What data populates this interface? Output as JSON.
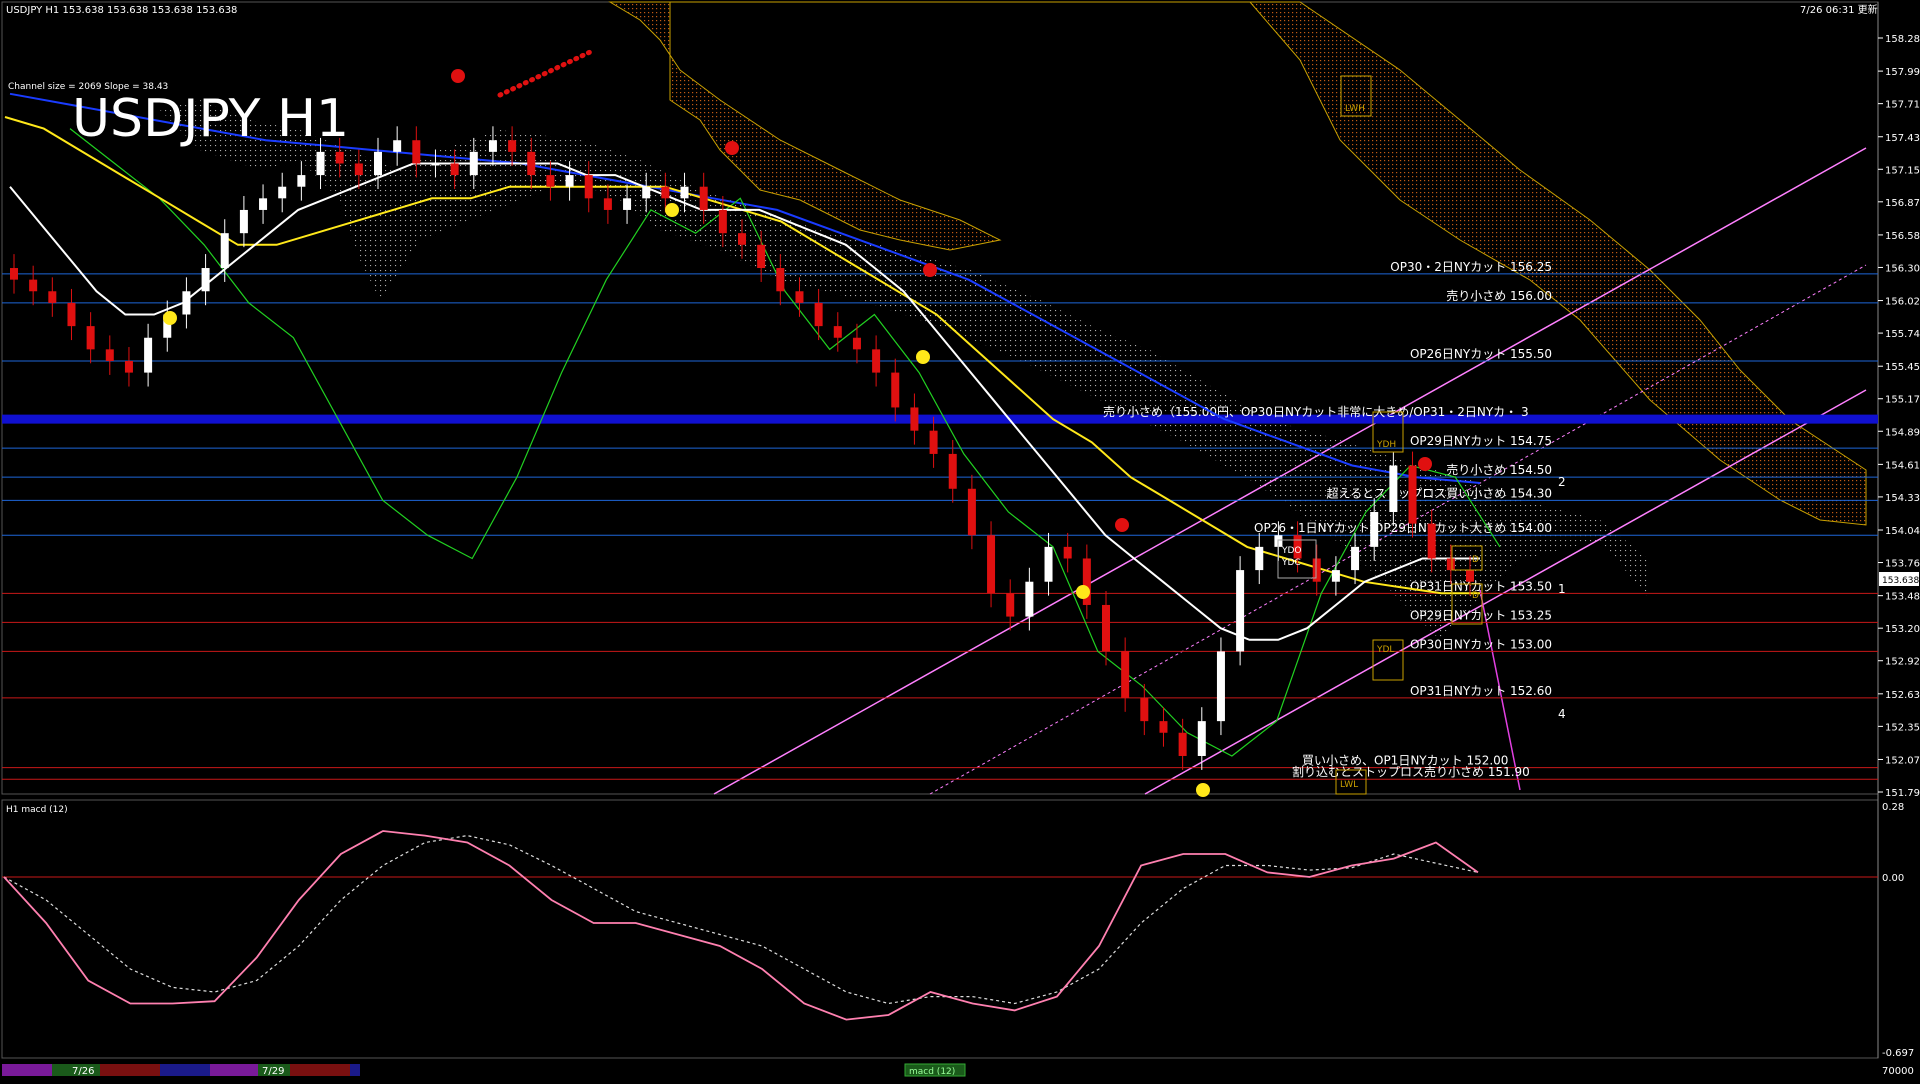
{
  "window": {
    "title": "USDJPY H1 153.638 153.638 153.638 153.638",
    "time_stamp": "7/26 06:31 更新",
    "big_title": "USDJPY H1",
    "channel_info": "Channel size = 2069 Slope = 38.43",
    "macd_title": "H1 macd (12)",
    "macd_scroll_label": "macd (12)",
    "bid_price": "153.638"
  },
  "price_axis": {
    "min": 151.79,
    "max": 158.28,
    "ticks": [
      "158.280",
      "157.995",
      "157.715",
      "157.430",
      "157.150",
      "156.870",
      "156.585",
      "156.305",
      "156.020",
      "155.740",
      "155.455",
      "155.175",
      "154.895",
      "154.610",
      "154.330",
      "154.045",
      "153.765",
      "153.480",
      "153.200",
      "152.920",
      "152.635",
      "152.355",
      "152.070",
      "151.790"
    ]
  },
  "macd_axis": {
    "ticks": [
      "0.28",
      "0.00",
      "-0.697"
    ]
  },
  "bottom_axis": {
    "dates": [
      "7/26",
      "7/29"
    ],
    "right_label": "70000"
  },
  "levels": [
    {
      "label": "OP30・2日NYカット 156.25",
      "price": 156.25,
      "color": "#1e66d8"
    },
    {
      "label": "売り小さめ 156.00",
      "price": 156.0,
      "color": "#1e66d8"
    },
    {
      "label": "OP26日NYカット 155.50",
      "price": 155.5,
      "color": "#1e66d8"
    },
    {
      "label": "売り小さめ（155.00円、OP30日NYカット非常に大きめ/OP31・2日NYカ・ 3",
      "price": 155.0,
      "color": "#1010d0"
    },
    {
      "label": "OP29日NYカット 154.75",
      "price": 154.75,
      "color": "#1e66d8"
    },
    {
      "label": "売り小さめ 154.50",
      "price": 154.5,
      "color": "#1e66d8"
    },
    {
      "label": "超えるとストップロス買い小さめ 154.30",
      "price": 154.3,
      "color": "#1e66d8"
    },
    {
      "label": "OP26・1日NYカット/OP29日NYカット大きめ 154.00",
      "price": 154.0,
      "color": "#1e66d8"
    },
    {
      "label": "OP31日NYカット 153.50",
      "price": 153.5,
      "color": "#c81818"
    },
    {
      "label": "OP29日NYカット 153.25",
      "price": 153.25,
      "color": "#c81818"
    },
    {
      "label": "OP30日NYカット 153.00",
      "price": 153.0,
      "color": "#c81818"
    },
    {
      "label": "OP31日NYカット 152.60",
      "price": 152.6,
      "color": "#c81818"
    },
    {
      "label": "買い小さめ、OP1日NYカット 152.00",
      "price": 152.0,
      "color": "#c81818"
    },
    {
      "label": "割り込むとストップロス売り小さめ 151.90",
      "price": 151.9,
      "color": "#c81818"
    }
  ],
  "side_numbers": [
    "2",
    "1",
    "4"
  ],
  "box_labels": [
    "LWH",
    "YDH",
    "YDL",
    "LWL",
    "YDO",
    "YDC",
    "D",
    "D"
  ],
  "colors": {
    "bull": "#ffffff",
    "bear": "#e01010",
    "white_ma": "#ffffff",
    "yellow_ma": "#ffe81a",
    "blue_ma": "#1a3cff",
    "green": "#21d021",
    "red_band": "#d81010",
    "magenta": "#ff80ff",
    "cloud_orange": "#c05a14",
    "cloud_white": "#d8d8d8"
  },
  "series": {
    "close": [
      156.2,
      156.1,
      156.0,
      155.8,
      155.6,
      155.5,
      155.4,
      155.7,
      155.9,
      156.1,
      156.3,
      156.6,
      156.8,
      156.9,
      157.0,
      157.1,
      157.3,
      157.2,
      157.1,
      157.3,
      157.4,
      157.2,
      157.2,
      157.1,
      157.3,
      157.4,
      157.3,
      157.1,
      157.0,
      157.1,
      156.9,
      156.8,
      156.9,
      157.0,
      156.9,
      157.0,
      156.8,
      156.6,
      156.5,
      156.3,
      156.1,
      156.0,
      155.8,
      155.7,
      155.6,
      155.4,
      155.1,
      154.9,
      154.7,
      154.4,
      154.0,
      153.5,
      153.3,
      153.6,
      153.9,
      153.8,
      153.4,
      153.0,
      152.6,
      152.4,
      152.3,
      152.1,
      152.4,
      153.0,
      153.7,
      153.9,
      154.0,
      153.8,
      153.6,
      153.7,
      153.9,
      154.2,
      154.6,
      154.1,
      153.8,
      153.7,
      153.6
    ],
    "white_ma": [
      157.0,
      156.7,
      156.4,
      156.1,
      155.9,
      155.9,
      156.0,
      156.2,
      156.4,
      156.6,
      156.8,
      156.9,
      157.0,
      157.1,
      157.2,
      157.2,
      157.2,
      157.2,
      157.2,
      157.2,
      157.1,
      157.1,
      157.0,
      156.9,
      156.8,
      156.8,
      156.8,
      156.7,
      156.6,
      156.5,
      156.3,
      156.1,
      155.8,
      155.5,
      155.2,
      154.9,
      154.6,
      154.3,
      154.0,
      153.8,
      153.6,
      153.4,
      153.2,
      153.1,
      153.1,
      153.2,
      153.4,
      153.6,
      153.7,
      153.8,
      153.8,
      153.8
    ],
    "yellow_ma": [
      157.6,
      157.5,
      157.3,
      157.1,
      156.9,
      156.7,
      156.5,
      156.5,
      156.6,
      156.7,
      156.8,
      156.9,
      156.9,
      157.0,
      157.0,
      157.0,
      157.0,
      157.0,
      156.9,
      156.8,
      156.7,
      156.5,
      156.3,
      156.1,
      155.9,
      155.6,
      155.3,
      155.0,
      154.8,
      154.5,
      154.3,
      154.1,
      153.9,
      153.8,
      153.7,
      153.6,
      153.55,
      153.5,
      153.5
    ],
    "blue_ma": [
      157.8,
      157.7,
      157.6,
      157.5,
      157.4,
      157.35,
      157.3,
      157.25,
      157.2,
      157.1,
      157.0,
      156.9,
      156.8,
      156.6,
      156.4,
      156.2,
      155.9,
      155.6,
      155.3,
      155.0,
      154.8,
      154.6,
      154.5,
      154.45
    ],
    "green": [
      157.5,
      157.2,
      156.9,
      156.5,
      156.0,
      155.7,
      155.0,
      154.3,
      154.0,
      153.8,
      154.5,
      155.4,
      156.2,
      156.8,
      156.6,
      156.9,
      156.1,
      155.6,
      155.9,
      155.4,
      154.7,
      154.2,
      153.9,
      153.0,
      152.7,
      152.3,
      152.1,
      152.4,
      153.5,
      154.2,
      154.6,
      154.5,
      153.9
    ],
    "macd": [
      0.0,
      -0.2,
      -0.45,
      -0.55,
      -0.55,
      -0.54,
      -0.35,
      -0.1,
      0.1,
      0.2,
      0.18,
      0.15,
      0.05,
      -0.1,
      -0.2,
      -0.2,
      -0.25,
      -0.3,
      -0.4,
      -0.55,
      -0.62,
      -0.6,
      -0.5,
      -0.55,
      -0.58,
      -0.52,
      -0.3,
      0.05,
      0.1,
      0.1,
      0.02,
      0.0,
      0.05,
      0.08,
      0.15,
      0.02
    ],
    "signal": [
      0.0,
      -0.1,
      -0.25,
      -0.4,
      -0.48,
      -0.5,
      -0.45,
      -0.3,
      -0.1,
      0.05,
      0.15,
      0.18,
      0.14,
      0.05,
      -0.05,
      -0.15,
      -0.2,
      -0.25,
      -0.3,
      -0.4,
      -0.5,
      -0.55,
      -0.52,
      -0.52,
      -0.55,
      -0.5,
      -0.4,
      -0.2,
      -0.05,
      0.05,
      0.05,
      0.03,
      0.04,
      0.1,
      0.06,
      0.02
    ]
  }
}
